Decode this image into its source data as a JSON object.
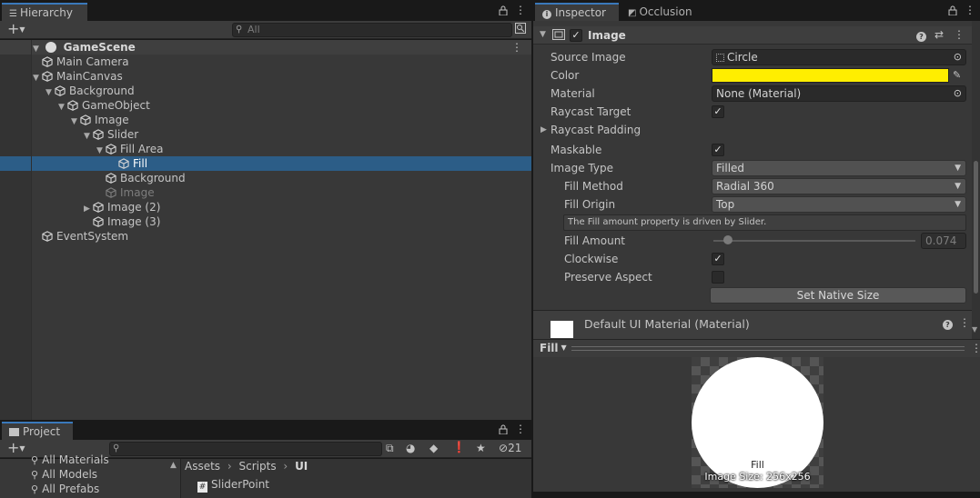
{
  "hierarchy": {
    "tab_label": "Hierarchy",
    "search_placeholder": "All",
    "scene_name": "GameScene",
    "items": [
      {
        "label": "Main Camera",
        "depth": 1,
        "expanded": null,
        "selected": false,
        "muted": false
      },
      {
        "label": "MainCanvas",
        "depth": 1,
        "expanded": true,
        "selected": false,
        "muted": false
      },
      {
        "label": "Background",
        "depth": 2,
        "expanded": true,
        "selected": false,
        "muted": false
      },
      {
        "label": "GameObject",
        "depth": 3,
        "expanded": true,
        "selected": false,
        "muted": false
      },
      {
        "label": "Image",
        "depth": 4,
        "expanded": true,
        "selected": false,
        "muted": false
      },
      {
        "label": "Slider",
        "depth": 5,
        "expanded": true,
        "selected": false,
        "muted": false
      },
      {
        "label": "Fill Area",
        "depth": 6,
        "expanded": true,
        "selected": false,
        "muted": false
      },
      {
        "label": "Fill",
        "depth": 7,
        "expanded": null,
        "selected": true,
        "muted": false
      },
      {
        "label": "Background",
        "depth": 6,
        "expanded": null,
        "selected": false,
        "muted": false
      },
      {
        "label": "Image",
        "depth": 6,
        "expanded": null,
        "selected": false,
        "muted": true
      },
      {
        "label": "Image (2)",
        "depth": 5,
        "expanded": false,
        "selected": false,
        "muted": false
      },
      {
        "label": "Image (3)",
        "depth": 5,
        "expanded": null,
        "selected": false,
        "muted": false
      },
      {
        "label": "EventSystem",
        "depth": 1,
        "expanded": null,
        "selected": false,
        "muted": false
      }
    ]
  },
  "project": {
    "tab_label": "Project",
    "hidden_count": "21",
    "favorites": [
      "All Materials",
      "All Models",
      "All Prefabs"
    ],
    "breadcrumb": [
      "Assets",
      "Scripts",
      "UI"
    ],
    "files": [
      "SliderPoint"
    ]
  },
  "inspector": {
    "tab_label": "Inspector",
    "occlusion_tab_label": "Occlusion",
    "component_title": "Image",
    "source_image_label": "Source Image",
    "source_image_value": "Circle",
    "color_label": "Color",
    "color_value": "#ffee00",
    "material_label": "Material",
    "material_value": "None (Material)",
    "raycast_target_label": "Raycast Target",
    "raycast_padding_label": "Raycast Padding",
    "maskable_label": "Maskable",
    "image_type_label": "Image Type",
    "image_type_value": "Filled",
    "fill_method_label": "Fill Method",
    "fill_method_value": "Radial 360",
    "fill_origin_label": "Fill Origin",
    "fill_origin_value": "Top",
    "help_text": "The Fill amount property is driven by Slider.",
    "fill_amount_label": "Fill Amount",
    "fill_amount_value": "0.074",
    "clockwise_label": "Clockwise",
    "preserve_aspect_label": "Preserve Aspect",
    "native_size_button": "Set Native Size",
    "material_section_title": "Default UI Material (Material)"
  },
  "preview": {
    "dropdown_label": "Fill",
    "caption_name": "Fill",
    "caption_size": "Image Size: 256x256"
  }
}
